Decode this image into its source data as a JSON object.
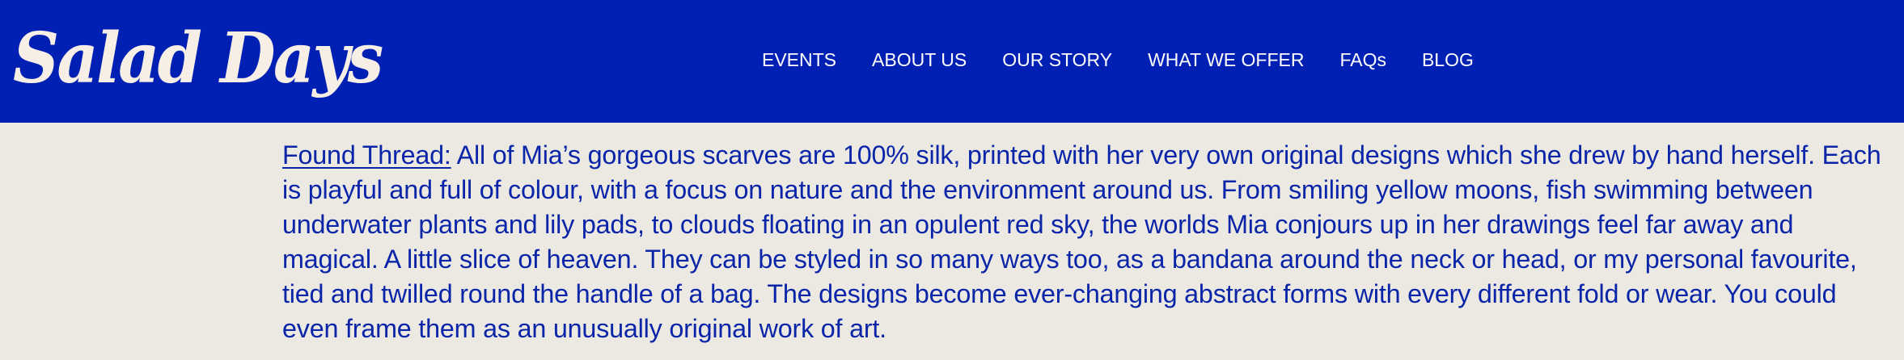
{
  "header": {
    "logo_text": "Salad Days",
    "background_color": "#0020b4",
    "nav": [
      {
        "label": "EVENTS"
      },
      {
        "label": "ABOUT US"
      },
      {
        "label": "OUR STORY"
      },
      {
        "label": "WHAT WE OFFER"
      },
      {
        "label": "FAQs"
      },
      {
        "label": "BLOG"
      }
    ]
  },
  "main": {
    "paragraph": {
      "link_text": "Found Thread:",
      "body": " All of Mia’s gorgeous scarves are 100% silk, printed with her very own original designs which she drew by hand herself. Each is playful and full of colour, with a focus on nature and the environment around us. From smiling yellow moons, fish swimming between underwater plants and lily pads, to clouds floating in an opulent red sky, the worlds Mia conjours up in her drawings feel far away and magical. A little slice of heaven. They can be styled in so many ways too, as a bandana around the neck or head, or my personal favourite, tied and twilled round the handle of a bag. The designs become ever-changing abstract forms with every different fold or wear. You could even frame them as an unusually original work of art.",
      "text_color": "#0b25a8"
    },
    "background_color": "#ece9e3"
  }
}
